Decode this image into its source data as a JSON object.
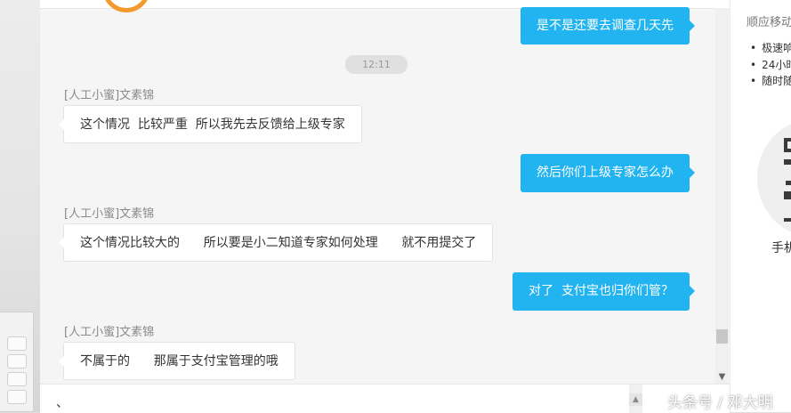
{
  "chat": {
    "timestamp": "12:11",
    "messages": [
      {
        "direction": "out",
        "text": "是不是还要去调查几天先"
      },
      {
        "direction": "in",
        "sender": "[人工小蜜]文素锦",
        "text": "这个情况  比较严重  所以我先去反馈给上级专家"
      },
      {
        "direction": "out",
        "text": "然后你们上级专家怎么办"
      },
      {
        "direction": "in",
        "sender": "[人工小蜜]文素锦",
        "text": "这个情况比较大的      所以要是小二知道专家如何处理      就不用提交了"
      },
      {
        "direction": "out",
        "text": "对了  支付宝也归你们管？"
      },
      {
        "direction": "in",
        "sender": "[人工小蜜]文素锦",
        "text": "不属于的      那属于支付宝管理的哦"
      }
    ],
    "input_value": "、"
  },
  "side_panel": {
    "title": "顺应移动",
    "features": [
      "极速响",
      "24小时",
      "随时随"
    ],
    "caption": "手机"
  },
  "watermark": "头条号 / 邓大明",
  "colors": {
    "outgoing_bubble": "#22b4f0",
    "incoming_bubble": "#ffffff",
    "logo_ring": "#f39a2c"
  }
}
